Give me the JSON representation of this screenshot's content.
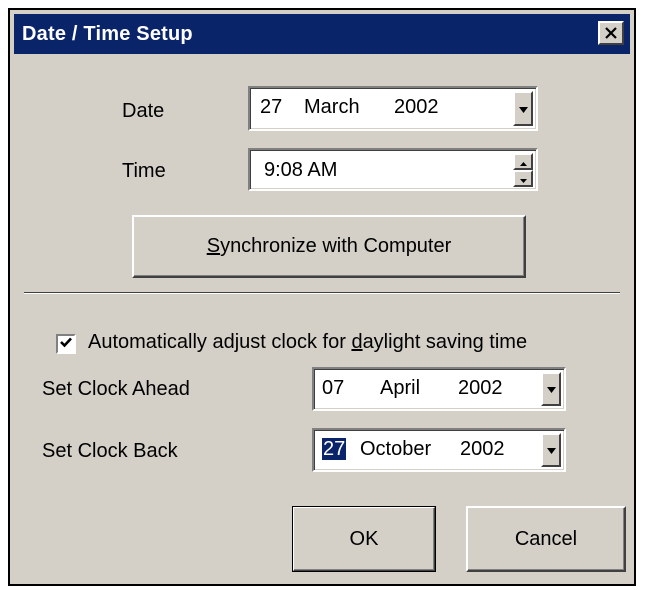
{
  "window": {
    "title": "Date / Time Setup",
    "close_icon": "close-icon"
  },
  "date": {
    "label": "Date",
    "day": "27",
    "month": "March",
    "year": "2002"
  },
  "time": {
    "label": "Time",
    "value": "9:08 AM"
  },
  "sync_button": {
    "mnemonic": "S",
    "rest": "ynchronize with Computer"
  },
  "dst": {
    "checked": true,
    "label_before": "Automatically adjust clock for ",
    "label_mnemonic": "d",
    "label_after": "aylight saving time"
  },
  "clock_ahead": {
    "label": "Set Clock Ahead",
    "day": "07",
    "month": "April",
    "year": "2002"
  },
  "clock_back": {
    "label": "Set Clock Back",
    "day": "27",
    "month": "October",
    "year": "2002"
  },
  "buttons": {
    "ok": "OK",
    "cancel": "Cancel"
  },
  "colors": {
    "titlebar": "#0a246a",
    "face": "#d4d0c8",
    "selection": "#0a246a"
  }
}
